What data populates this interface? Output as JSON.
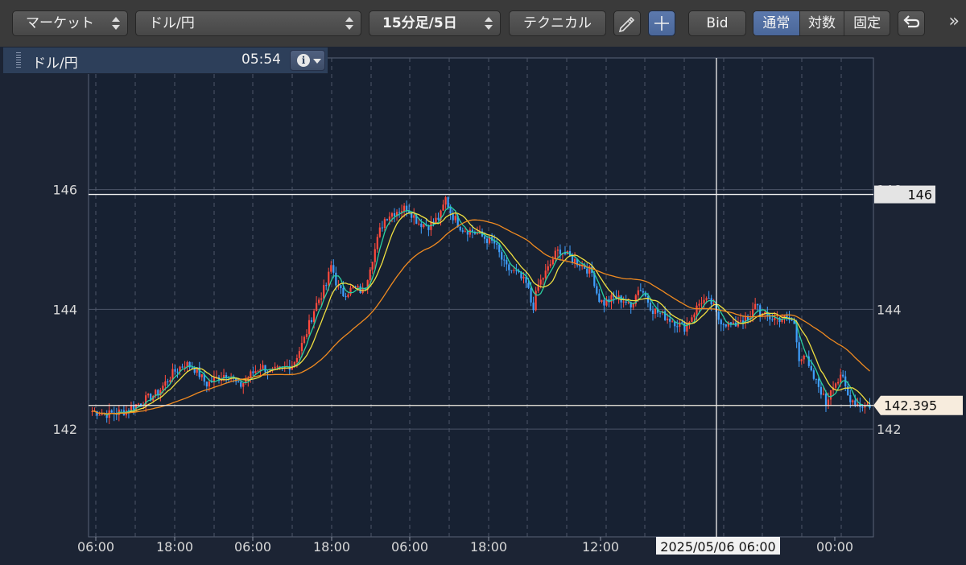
{
  "toolbar": {
    "market_label": "マーケット",
    "symbol_label": "ドル/円",
    "period_label": "15分足/5日",
    "technical_label": "テクニカル",
    "pencil_icon": "pencil-icon",
    "crosshair_icon": "crosshair-icon",
    "bid_label": "Bid",
    "scale_modes": [
      "通常",
      "対数",
      "固定"
    ],
    "active_scale": "通常",
    "undo_icon": "undo-icon",
    "more_icon": "double-chevron-right-icon",
    "more_label": "»"
  },
  "panel": {
    "title": "ドル/円",
    "time": "05:54",
    "info_icon": "info-icon"
  },
  "chart_data": {
    "type": "candlestick",
    "instrument": "ドル/円",
    "interval": "15分足/5日",
    "ylim": [
      140.2,
      148.2
    ],
    "y_ticks": [
      142,
      144,
      146
    ],
    "y_tick_labels": [
      "142",
      "144",
      "146"
    ],
    "x_ticks": [
      "06:00",
      "18:00",
      "06:00",
      "18:00",
      "06:00",
      "18:00",
      "12:00",
      "00:00"
    ],
    "crosshair": {
      "x_label": "2025/05/06 06:00",
      "y_label": "146",
      "y_value": 145.92
    },
    "last_price": {
      "label": "142.395",
      "value": 142.395
    },
    "price_path": [
      [
        0,
        142.3
      ],
      [
        3,
        142.25
      ],
      [
        6,
        142.3
      ],
      [
        9,
        142.45
      ],
      [
        12,
        142.6
      ],
      [
        15,
        142.95
      ],
      [
        17,
        143.1
      ],
      [
        19,
        143.0
      ],
      [
        21,
        142.75
      ],
      [
        23,
        142.85
      ],
      [
        25,
        142.95
      ],
      [
        27,
        142.7
      ],
      [
        29,
        142.9
      ],
      [
        31,
        143.05
      ],
      [
        33,
        142.95
      ],
      [
        35,
        143.0
      ],
      [
        37,
        143.1
      ],
      [
        39,
        143.5
      ],
      [
        41,
        144.05
      ],
      [
        43,
        144.4
      ],
      [
        44,
        144.75
      ],
      [
        45,
        144.4
      ],
      [
        46,
        144.25
      ],
      [
        48,
        144.35
      ],
      [
        50,
        144.3
      ],
      [
        51,
        144.7
      ],
      [
        52,
        145.0
      ],
      [
        53,
        145.35
      ],
      [
        54,
        145.55
      ],
      [
        56,
        145.65
      ],
      [
        58,
        145.7
      ],
      [
        60,
        145.45
      ],
      [
        62,
        145.4
      ],
      [
        64,
        145.55
      ],
      [
        65,
        145.85
      ],
      [
        66,
        145.6
      ],
      [
        68,
        145.35
      ],
      [
        70,
        145.3
      ],
      [
        72,
        145.2
      ],
      [
        74,
        145.1
      ],
      [
        76,
        144.7
      ],
      [
        78,
        144.6
      ],
      [
        80,
        144.4
      ],
      [
        81,
        144.0
      ],
      [
        82,
        144.4
      ],
      [
        84,
        144.7
      ],
      [
        85,
        144.9
      ],
      [
        86,
        145.0
      ],
      [
        88,
        144.85
      ],
      [
        90,
        144.75
      ],
      [
        92,
        144.6
      ],
      [
        93,
        144.2
      ],
      [
        94,
        144.1
      ],
      [
        96,
        144.2
      ],
      [
        98,
        144.15
      ],
      [
        99,
        144.0
      ],
      [
        100,
        144.3
      ],
      [
        101,
        144.35
      ],
      [
        103,
        144.0
      ],
      [
        105,
        143.9
      ],
      [
        107,
        143.8
      ],
      [
        109,
        143.7
      ],
      [
        110,
        143.85
      ],
      [
        112,
        144.15
      ],
      [
        114,
        144.1
      ],
      [
        115,
        143.85
      ],
      [
        117,
        143.75
      ],
      [
        118,
        143.7
      ],
      [
        119,
        143.85
      ],
      [
        121,
        143.8
      ],
      [
        122,
        144.15
      ],
      [
        123,
        143.9
      ],
      [
        125,
        143.85
      ],
      [
        127,
        143.85
      ],
      [
        129,
        143.8
      ],
      [
        130,
        143.2
      ],
      [
        131,
        143.25
      ],
      [
        132,
        142.95
      ],
      [
        134,
        142.65
      ],
      [
        135,
        142.4
      ],
      [
        136,
        142.75
      ],
      [
        138,
        142.85
      ],
      [
        139,
        142.55
      ],
      [
        141,
        142.4
      ],
      [
        143,
        142.4
      ]
    ]
  }
}
